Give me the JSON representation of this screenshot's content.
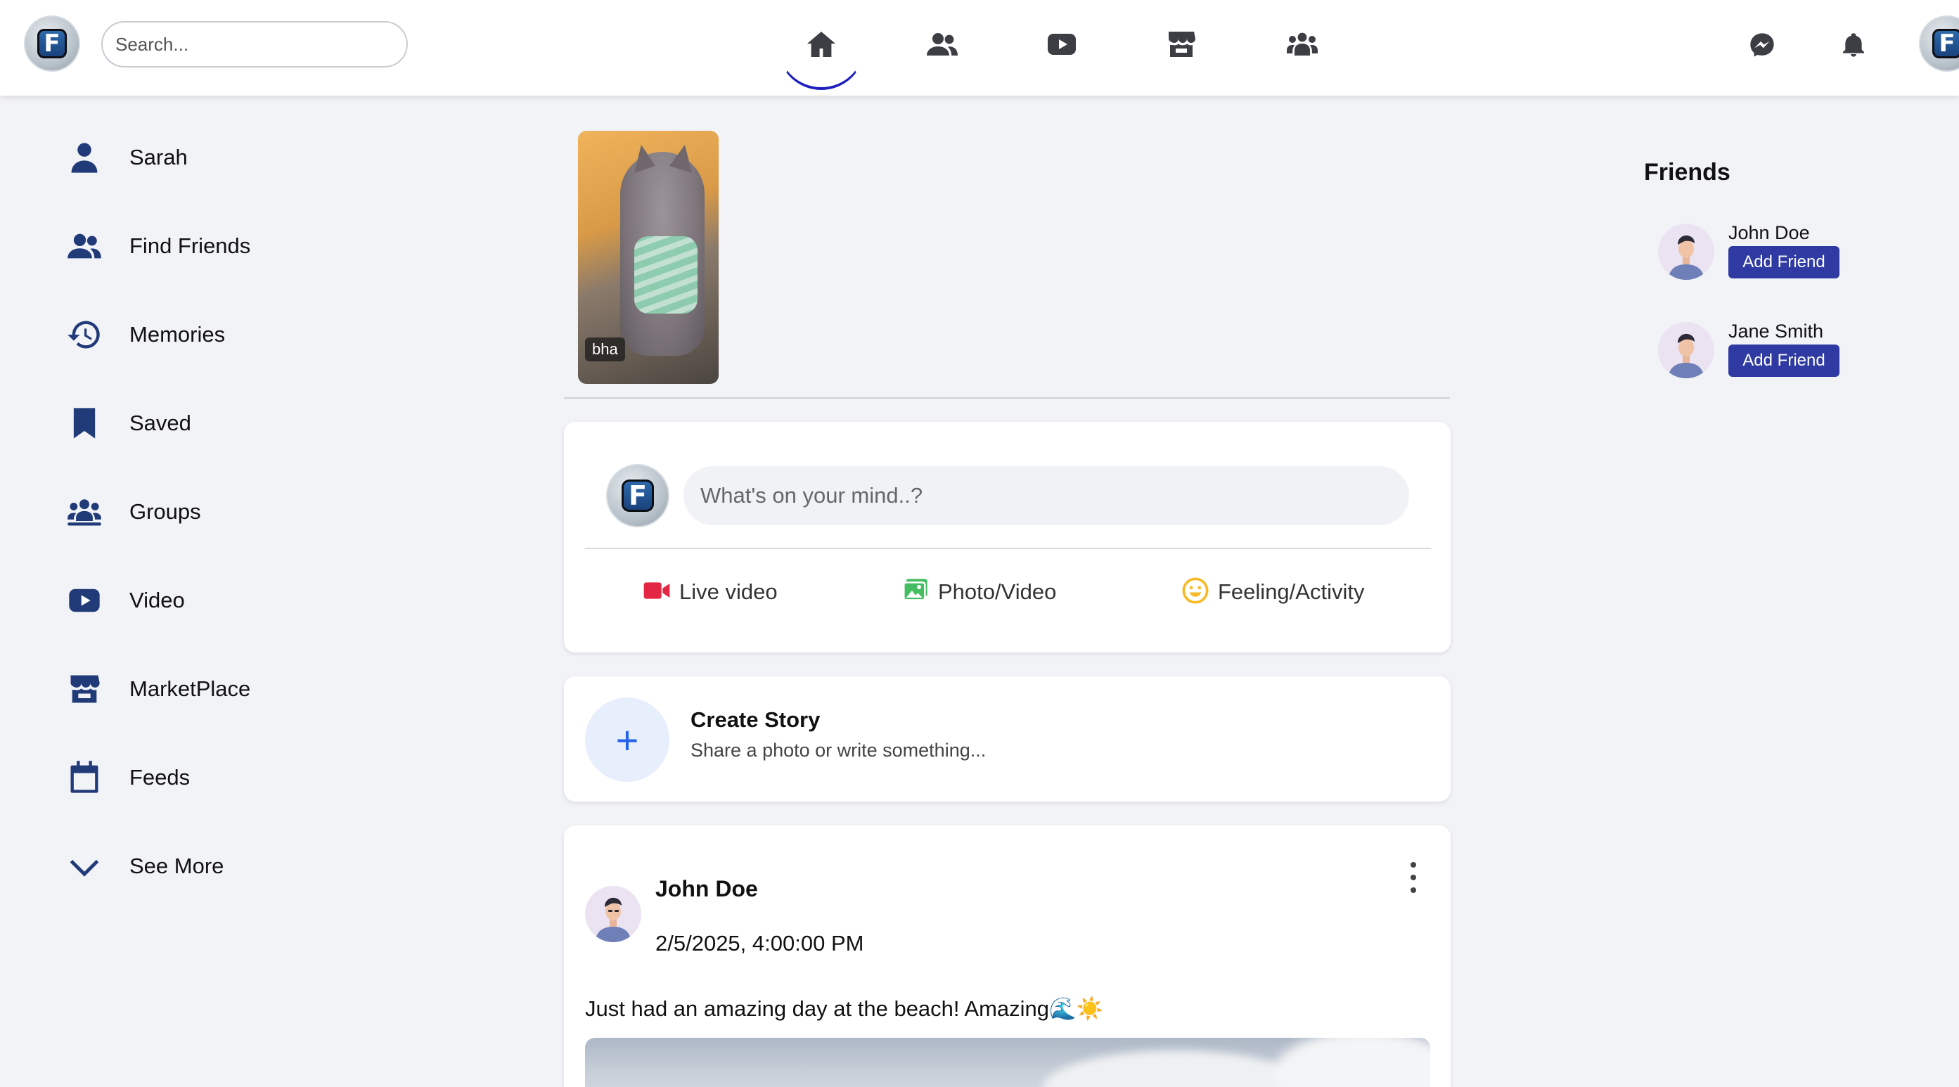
{
  "header": {
    "search_placeholder": "Search...",
    "logo_letter": "F",
    "nav_icons": [
      "home-icon",
      "friends-icon",
      "video-icon",
      "marketplace-icon",
      "groups-icon"
    ],
    "right_icons": [
      "messenger-icon",
      "bell-icon",
      "profile-avatar"
    ]
  },
  "sidebar": {
    "items": [
      {
        "label": "Sarah",
        "icon": "user-icon"
      },
      {
        "label": "Find Friends",
        "icon": "friends-icon"
      },
      {
        "label": "Memories",
        "icon": "history-icon"
      },
      {
        "label": "Saved",
        "icon": "bookmark-icon"
      },
      {
        "label": "Groups",
        "icon": "groups-icon"
      },
      {
        "label": "Video",
        "icon": "video-icon"
      },
      {
        "label": "MarketPlace",
        "icon": "store-icon"
      },
      {
        "label": "Feeds",
        "icon": "calendar-icon"
      },
      {
        "label": "See More",
        "icon": "chevron-down-icon"
      }
    ]
  },
  "stories": [
    {
      "label": "bha"
    }
  ],
  "composer": {
    "placeholder": "What's on your mind..?",
    "actions": [
      {
        "label": "Live video",
        "icon": "live-video-icon",
        "color": "#e42645"
      },
      {
        "label": "Photo/Video",
        "icon": "photo-icon",
        "color": "#45bd62"
      },
      {
        "label": "Feeling/Activity",
        "icon": "smile-icon",
        "color": "#f7b928"
      }
    ]
  },
  "create_story": {
    "plus": "+",
    "title": "Create Story",
    "subtitle": "Share a photo or write something..."
  },
  "post": {
    "author": "John Doe",
    "date": "2/5/2025, 4:00:00 PM",
    "text": "Just had an amazing day at the beach! Amazing🌊☀️"
  },
  "friends": {
    "title": "Friends",
    "list": [
      {
        "name": "John Doe",
        "button": "Add Friend"
      },
      {
        "name": "Jane Smith",
        "button": "Add Friend"
      }
    ]
  },
  "colors": {
    "brand_navy": "#213a78",
    "add_friend_button": "#2f3ba3",
    "active_nav_underline": "#1d1fbf",
    "page_background": "#f2f3f7"
  }
}
